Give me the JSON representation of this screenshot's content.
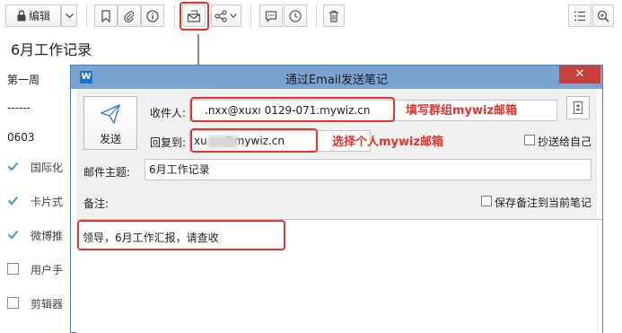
{
  "toolbar": {
    "edit_label": "编辑",
    "icons": [
      "lock-icon",
      "chevron-down-icon",
      "bookmark-icon",
      "paperclip-icon",
      "info-icon",
      "email-send-icon",
      "share-icon",
      "comment-icon",
      "clock-icon",
      "trash-icon",
      "outline-icon",
      "zoom-icon"
    ]
  },
  "note": {
    "title": "6月工作记录",
    "lines": [
      "第一周",
      "------",
      "0603"
    ],
    "tasks": [
      {
        "label": "国际化",
        "checked": true
      },
      {
        "label": "卡片式",
        "checked": true
      },
      {
        "label": "微博推",
        "checked": true
      },
      {
        "label": "用户手",
        "checked": false
      },
      {
        "label": "剪辑器",
        "checked": false
      }
    ]
  },
  "dialog": {
    "title": "通过Email发送笔记",
    "close_symbol": "✕",
    "app_icon_letter": "W",
    "send_label": "发送",
    "to_label": "收件人:",
    "to_value": ".nxx@xuxı        0129-071.mywiz.cn",
    "reply_label": "回复到:",
    "reply_value": "xu         xx@mywiz.cn",
    "cc_self_label": "抄送给自己",
    "subject_label": "邮件主题:",
    "subject_value": "6月工作记录",
    "remark_label": "备注:",
    "save_remark_label": "保存备注到当前笔记",
    "message": "领导，6月工作汇报，请查收"
  },
  "annotations": {
    "to_hint": "填写群组mywiz邮箱",
    "reply_hint": "选择个人mywiz邮箱"
  },
  "colors": {
    "highlight": "#e5332a",
    "titlebar": "#7aa3d1",
    "close": "#c7403a",
    "check": "#3c9bd6"
  }
}
